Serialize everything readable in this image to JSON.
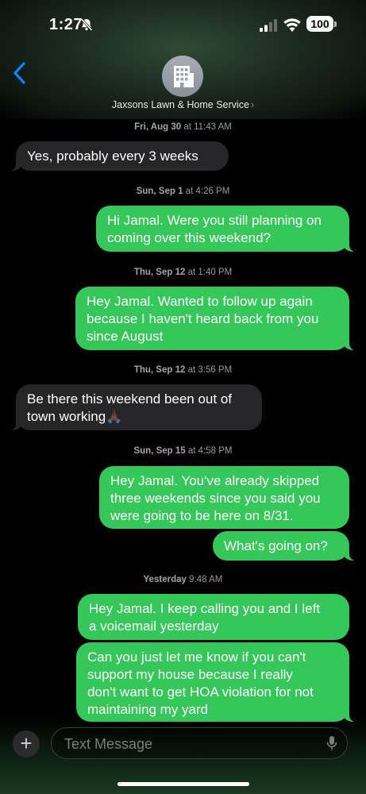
{
  "status": {
    "time": "1:27",
    "battery": "100"
  },
  "header": {
    "contact_name": "Jaxsons Lawn & Home Service",
    "chevron": "›"
  },
  "timestamps": [
    {
      "day": "Fri, Aug 30",
      "time": "at 11:43 AM"
    },
    {
      "day": "Sun, Sep 1",
      "time": "at 4:26 PM"
    },
    {
      "day": "Thu, Sep 12",
      "time": "at 1:40 PM"
    },
    {
      "day": "Thu, Sep 12",
      "time": "at 3:56 PM"
    },
    {
      "day": "Sun, Sep 15",
      "time": "at 4:58 PM"
    },
    {
      "day": "Yesterday",
      "time": "9:48 AM"
    }
  ],
  "messages": [
    {
      "direction": "incoming",
      "text": "Yes, probably  every 3 weeks"
    },
    {
      "direction": "outgoing",
      "text": "Hi Jamal. Were you still planning on\ncoming over this weekend?"
    },
    {
      "direction": "outgoing",
      "text": "Hey Jamal. Wanted to follow up again\nbecause I haven't heard back from you\nsince August"
    },
    {
      "direction": "incoming",
      "text": "Be there this weekend been out of\ntown working🙏🏿"
    },
    {
      "direction": "outgoing",
      "text": "Hey Jamal. You've already skipped\nthree weekends since you said you\nwere going to be here on 8/31."
    },
    {
      "direction": "outgoing",
      "text": "What's going on?"
    },
    {
      "direction": "outgoing",
      "text": "Hey Jamal. I keep calling you and I left\na voicemail yesterday"
    },
    {
      "direction": "outgoing",
      "text": "Can you just let me know if you can't\nsupport my house because I really\ndon't want to get HOA violation for not\nmaintaining my yard"
    }
  ],
  "compose": {
    "plus": "+",
    "placeholder": "Text Message"
  },
  "colors": {
    "outgoing": "#35c759",
    "incoming": "#262628",
    "accent": "#0a84ff"
  },
  "icons": [
    "bell-slash-icon",
    "signal-icon",
    "wifi-icon",
    "battery-icon",
    "back-chevron-icon",
    "building-icon",
    "plus-icon",
    "microphone-icon"
  ]
}
